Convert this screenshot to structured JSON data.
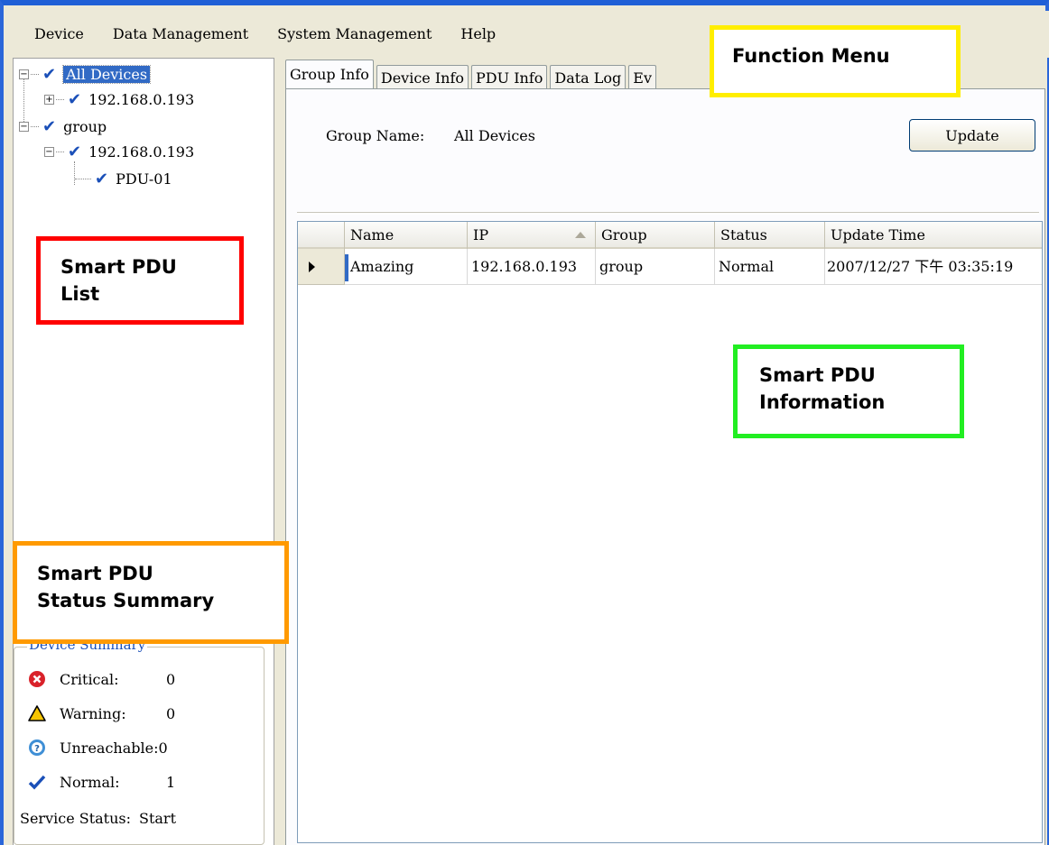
{
  "menu": {
    "items": [
      {
        "label": "Device"
      },
      {
        "label": "Data Management"
      },
      {
        "label": "System Management"
      },
      {
        "label": "Help"
      }
    ]
  },
  "tree": {
    "nodes": [
      {
        "label": "All Devices",
        "selected": true
      },
      {
        "label": "192.168.0.193"
      },
      {
        "label": "group"
      },
      {
        "label": "192.168.0.193"
      },
      {
        "label": "PDU-01"
      }
    ]
  },
  "tabs": [
    {
      "label": "Group Info",
      "active": true
    },
    {
      "label": "Device Info"
    },
    {
      "label": "PDU Info"
    },
    {
      "label": "Data Log"
    },
    {
      "label": "Ev"
    }
  ],
  "group_info": {
    "group_name_label": "Group Name:",
    "group_name_value": "All Devices",
    "update_button": "Update"
  },
  "grid": {
    "columns": [
      "Name",
      "IP",
      "Group",
      "Status",
      "Update Time"
    ],
    "rows": [
      {
        "name": "Amazing",
        "ip": "192.168.0.193",
        "group": "group",
        "status": "Normal",
        "update_time": "2007/12/27 下午 03:35:19"
      }
    ]
  },
  "summary": {
    "legend": "Device Summary",
    "critical_label": "Critical:",
    "critical_value": "0",
    "warning_label": "Warning:",
    "warning_value": "0",
    "unreachable_label": "Unreachable:",
    "unreachable_value": "0",
    "normal_label": "Normal:",
    "normal_value": "1",
    "service_label": "Service Status:",
    "service_value": "Start"
  },
  "callouts": {
    "function_menu": "Function Menu",
    "pdu_list_line1": "Smart PDU",
    "pdu_list_line2": "List",
    "pdu_info_line1": "Smart PDU",
    "pdu_info_line2": "Information",
    "status_line1": "Smart PDU",
    "status_line2": "Status Summary"
  },
  "colors": {
    "title_border": "#1f5fd6",
    "selection": "#316ac5",
    "callout_yellow": "#ffee00",
    "callout_red": "#ff0000",
    "callout_green": "#22ee22",
    "callout_orange": "#ff9a00"
  }
}
